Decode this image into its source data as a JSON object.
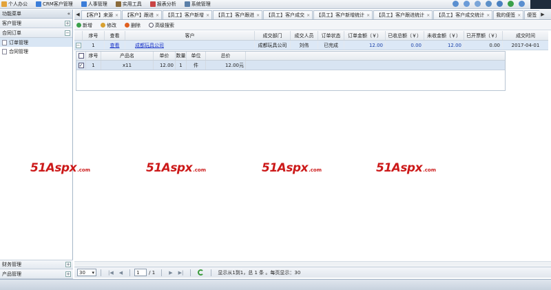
{
  "topmenu": [
    {
      "label": "个人办公",
      "icon": "person-icon",
      "color": "#e3a33a"
    },
    {
      "label": "CRM客户管理",
      "icon": "crm-icon",
      "color": "#3b7dd8"
    },
    {
      "label": "人事管理",
      "icon": "people-icon",
      "color": "#3b7dd8"
    },
    {
      "label": "实用工具",
      "icon": "tools-icon",
      "color": "#8a6a3a"
    },
    {
      "label": "报表分析",
      "icon": "report-icon",
      "color": "#c94444"
    },
    {
      "label": "系统管理",
      "icon": "gear-icon",
      "color": "#5a7fa8"
    }
  ],
  "sidebar": {
    "title": "功能菜单",
    "sections": [
      {
        "label": "客户管理"
      },
      {
        "label": "合同订单"
      }
    ],
    "items": [
      {
        "label": "订单管理"
      },
      {
        "label": "合同管理"
      }
    ],
    "bottom_sections": [
      {
        "label": "财务管理"
      },
      {
        "label": "产品管理"
      }
    ]
  },
  "tabs": [
    "【客户】来源",
    "【客户】跟进",
    "【员工】客户新增",
    "【员工】客户跟进",
    "【员工】客户成交",
    "【员工】客户新增统计",
    "【员工】客户跟进统计",
    "【员工】客户成交统计",
    "我的便签",
    "便签"
  ],
  "toolbar": {
    "add": "新增",
    "edit": "修改",
    "delete": "删除",
    "search": "高级搜索"
  },
  "grid": {
    "columns": [
      "序号",
      "查看",
      "客户",
      "成交部门",
      "成交人员",
      "订单状态",
      "订单金额（￥）",
      "已收总额（￥）",
      "未收金额（￥）",
      "已开票额（￥）",
      "成交时间"
    ],
    "rows": [
      {
        "expand": "−",
        "no": "1",
        "view": "查看",
        "customer": "成都玩具公司",
        "dept": "成都玩具公司",
        "person": "刘伟",
        "status": "已完成",
        "amount": "12.00",
        "received": "0.00",
        "unreceived": "12.00",
        "invoiced": "0.00",
        "date": "2017-04-01"
      }
    ]
  },
  "subgrid": {
    "columns": [
      "序号",
      "产品名",
      "单价",
      "数量",
      "单位",
      "总价"
    ],
    "rows": [
      {
        "no": "1",
        "name": "x11",
        "price": "12.00",
        "qty": "1",
        "unit": "件",
        "total": "12.00元"
      }
    ]
  },
  "watermark": {
    "brand": "51Aspx",
    "suffix": ".com"
  },
  "pager": {
    "page_size": "30",
    "page": "1",
    "total_pages": "/ 1",
    "summary": "显示从1到1，总 1 条 。每页显示：30"
  }
}
